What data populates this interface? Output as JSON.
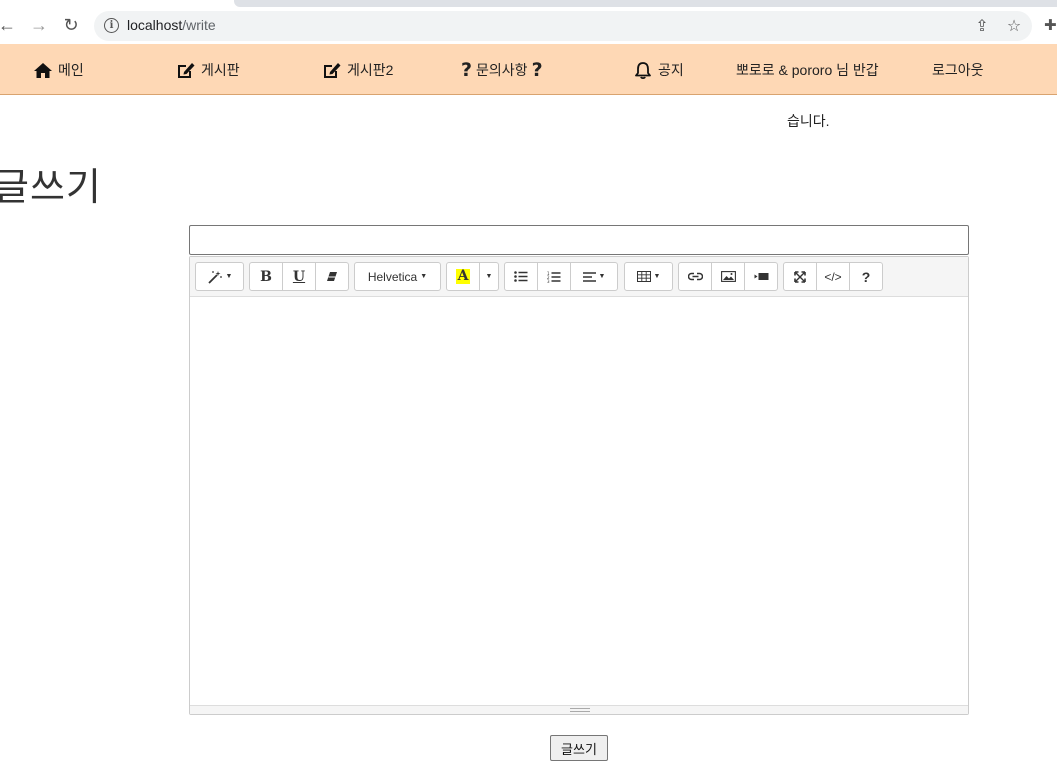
{
  "browser": {
    "url_host": "localhost",
    "url_path": "/write",
    "back_glyph": "←",
    "forward_glyph": "→",
    "reload_glyph": "↻",
    "info_glyph": "i",
    "share_glyph": "⇪",
    "star_glyph": "☆",
    "ext_glyph": "✚"
  },
  "navbar": {
    "items": [
      {
        "label": "메인",
        "icon": "home-icon"
      },
      {
        "label": "게시판",
        "icon": "edit-icon"
      },
      {
        "label": "게시판2",
        "icon": "edit-icon"
      },
      {
        "label": "문의사항",
        "icon": "question-icon",
        "q": "?"
      },
      {
        "label": "공지",
        "icon": "bell-icon"
      },
      {
        "label": "뽀로로 & pororo 님 반갑"
      },
      {
        "label": "로그아웃"
      }
    ],
    "greeting_overflow": "습니다.",
    "bg_color": "#fed8b5"
  },
  "page": {
    "title": "글쓰기",
    "title_input_value": "",
    "submit_label": "글쓰기"
  },
  "editor": {
    "font_name": "Helvetica",
    "bold_label": "B",
    "underline_label": "U",
    "color_label": "A",
    "help_label": "?",
    "code_label": "</>",
    "caret": "▼"
  }
}
